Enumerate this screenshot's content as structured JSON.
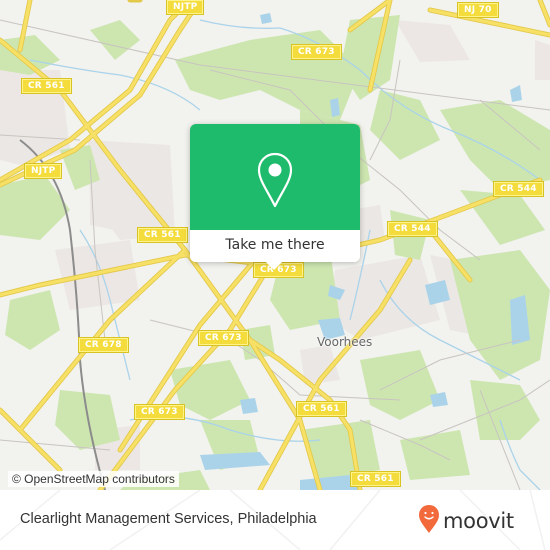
{
  "map": {
    "road_labels": [
      {
        "id": "njtp-top",
        "text": "NJTP"
      },
      {
        "id": "nj70",
        "text": "NJ 70"
      },
      {
        "id": "cr673-top",
        "text": "CR 673"
      },
      {
        "id": "cr561-nw",
        "text": "CR 561"
      },
      {
        "id": "njtp-left",
        "text": "NJTP"
      },
      {
        "id": "cr544-east",
        "text": "CR 544"
      },
      {
        "id": "cr544",
        "text": "CR 544"
      },
      {
        "id": "cr561-mid",
        "text": "CR 561"
      },
      {
        "id": "cr673-center",
        "text": "CR 673"
      },
      {
        "id": "cr678",
        "text": "CR 678"
      },
      {
        "id": "cr673-mid",
        "text": "CR 673"
      },
      {
        "id": "cr673-sw",
        "text": "CR 673"
      },
      {
        "id": "cr561-se",
        "text": "CR 561"
      },
      {
        "id": "cr561-south",
        "text": "CR 561"
      }
    ],
    "place_labels": [
      {
        "id": "voorhees",
        "text": "Voorhees"
      }
    ],
    "attribution": "© OpenStreetMap contributors",
    "colors": {
      "background": "#f2f2ee",
      "park": "#cde6b0",
      "water": "#aad3ea",
      "road_major": "#f7e066",
      "road_label": "#f4dc3c",
      "built_up": "#ebe6e3",
      "rail": "#888888"
    }
  },
  "popup": {
    "action_label": "Take me there",
    "icon": "location-pin-icon",
    "color": "#1fbb6c"
  },
  "footer": {
    "location_title": "Clearlight Management Services, Philadelphia",
    "brand_name": "moovit",
    "brand_color": "#f26a3c"
  }
}
